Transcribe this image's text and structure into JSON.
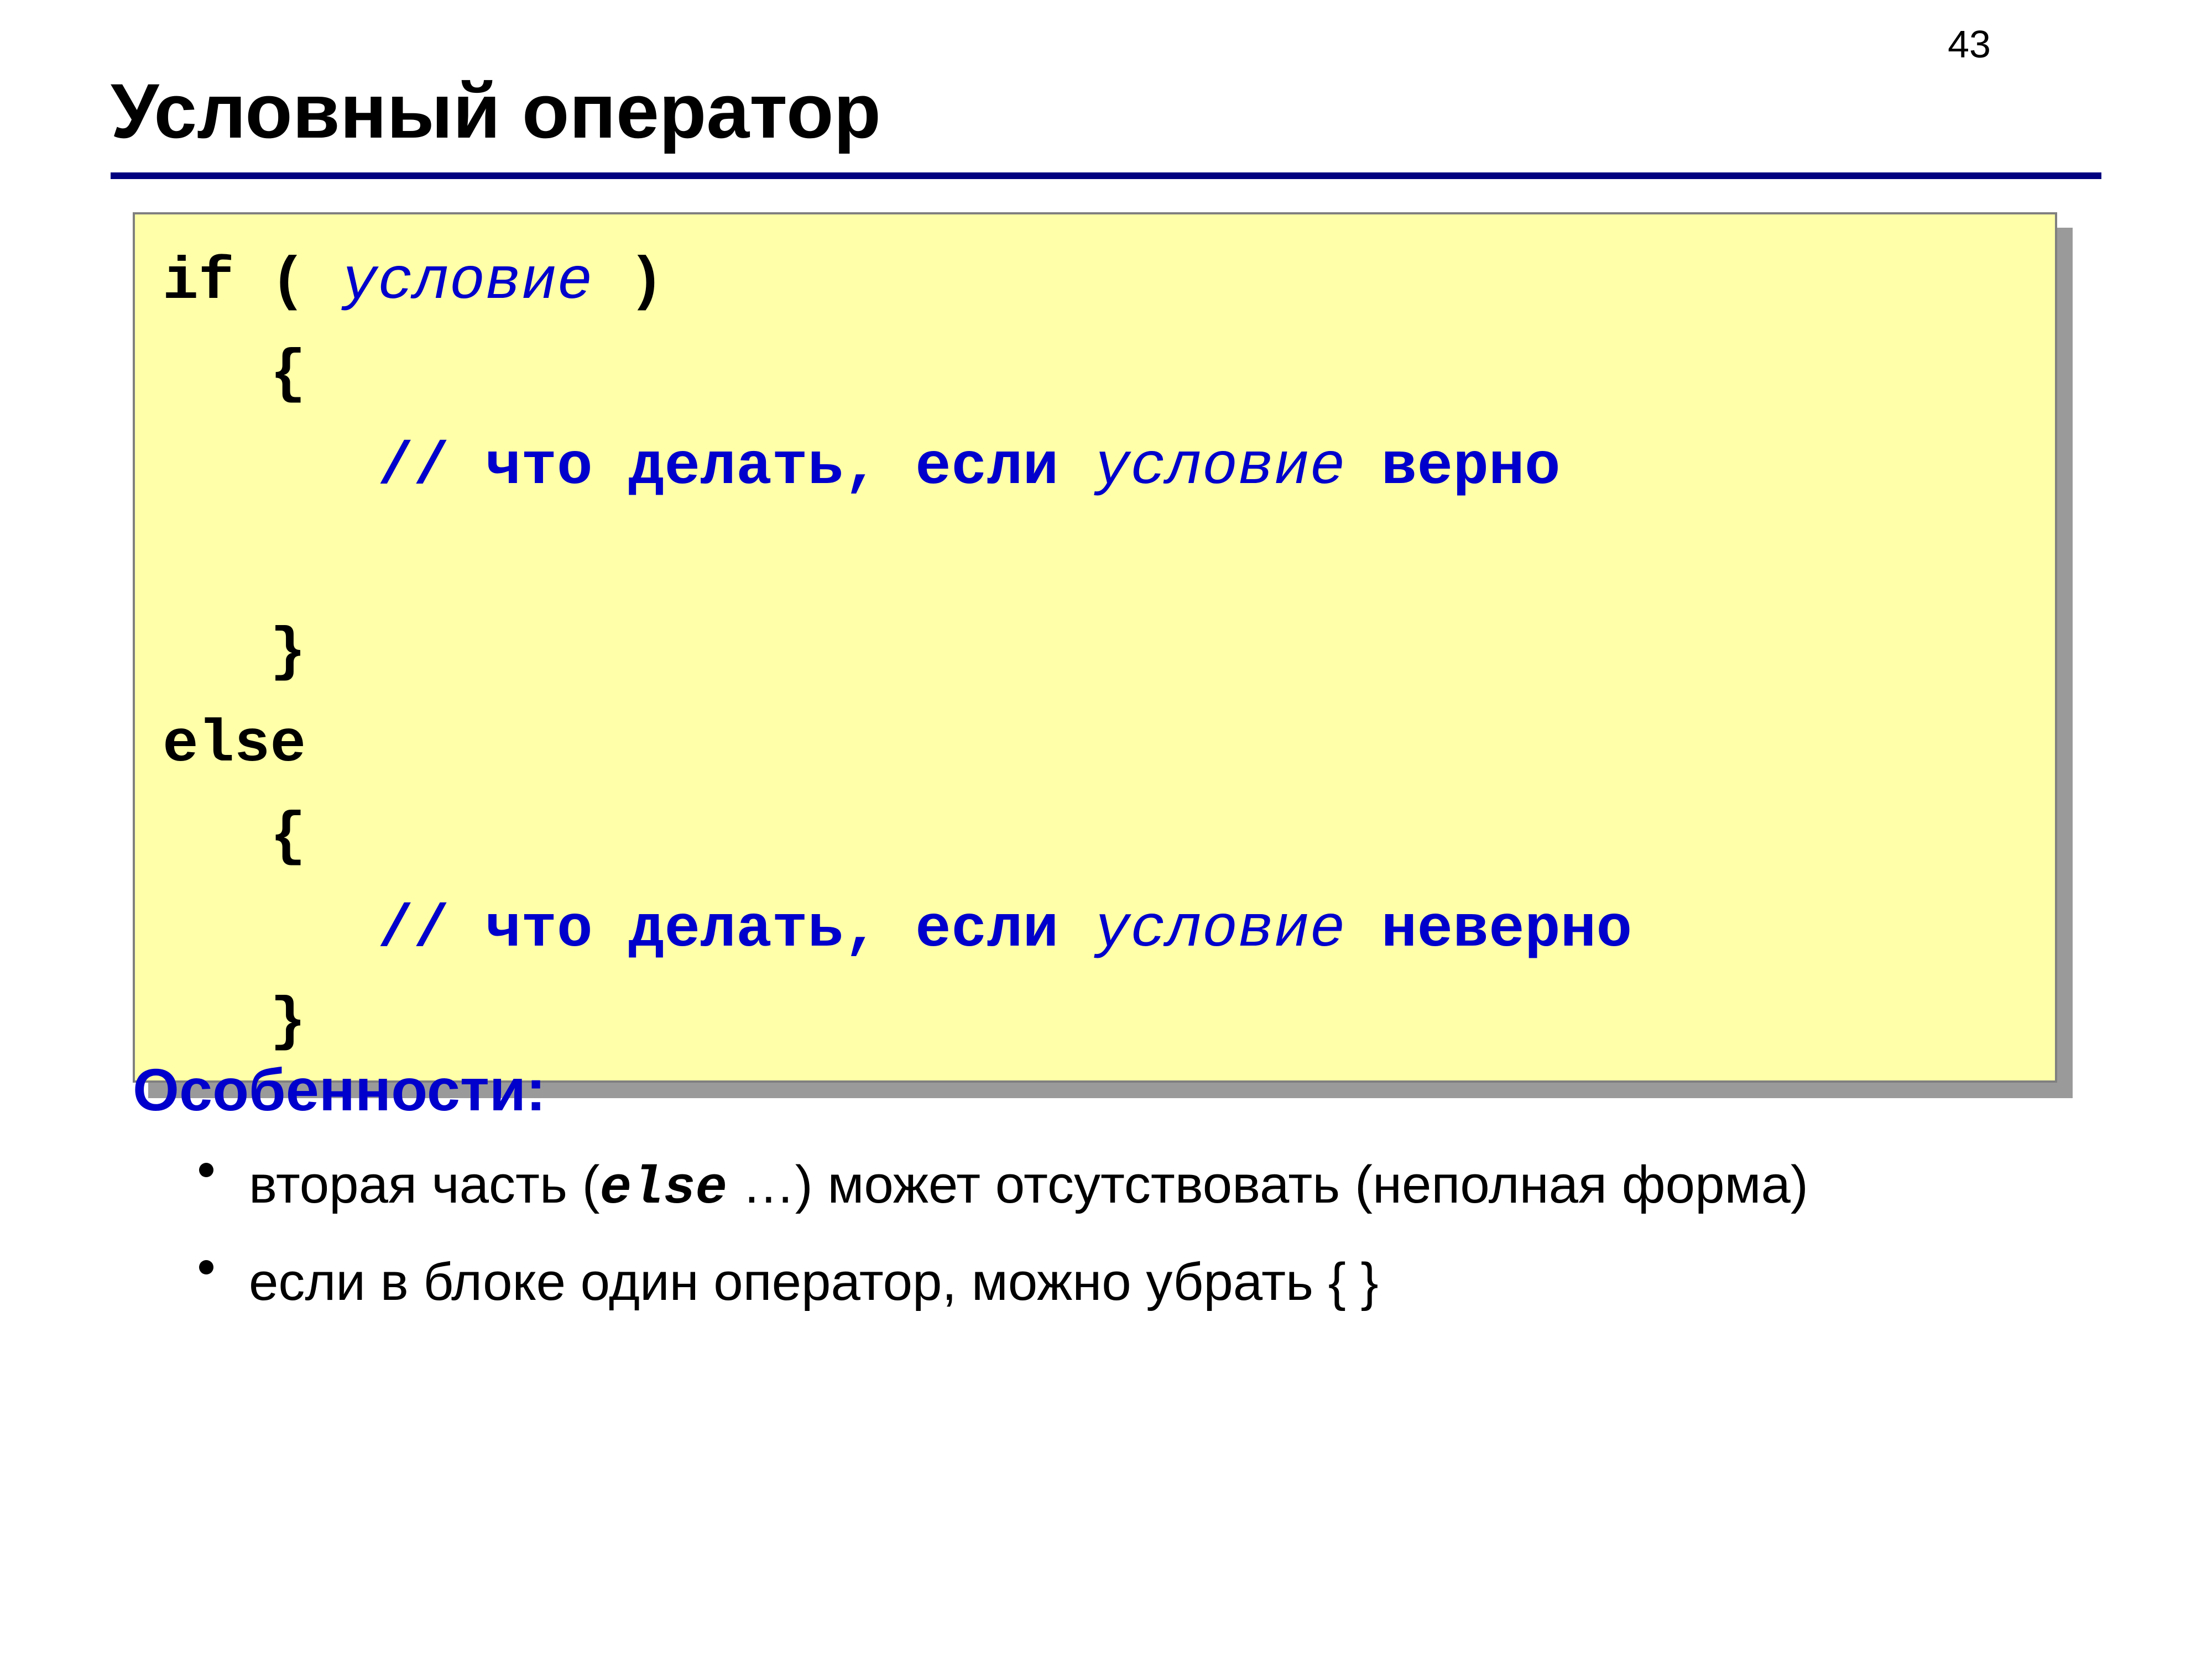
{
  "page_number": "43",
  "title": "Условный оператор",
  "code": {
    "l1_if": "if ( ",
    "l1_cond": "условие",
    "l1_close": " )",
    "l2": "   {",
    "l3_pad": "      ",
    "l3_cmt1": "// что делать, если ",
    "l3_cond": "условие",
    "l3_cmt2": " верно ",
    "l4": "",
    "l5": "   }",
    "l6": "else",
    "l7": "   {",
    "l8_pad": "      ",
    "l8_cmt1": "// что делать, если ",
    "l8_cond": "условие",
    "l8_cmt2": " неверно ",
    "l9": "   }"
  },
  "features_title": "Особенности:",
  "features": {
    "item1_a": "вторая часть (",
    "item1_else": "else",
    "item1_b": " …) может отсутствовать (неполная форма)",
    "item2": "если в блоке один оператор, можно убрать { }"
  }
}
